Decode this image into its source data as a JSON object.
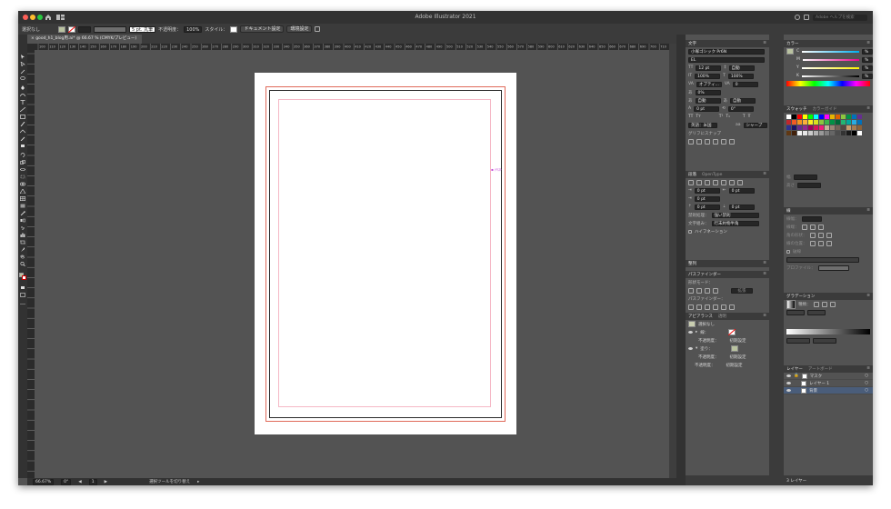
{
  "window": {
    "title": "Adobe Illustrator 2021",
    "help_search_placeholder": "Adobe ヘルプを検索"
  },
  "control_bar": {
    "selection_label": "選択なし",
    "stroke_weight": "",
    "brush_preset": "5 pt. 丸筆",
    "opacity_label": "不透明度：",
    "opacity_value": "100%",
    "style_label": "スタイル：",
    "document_setup_button": "ドキュメント設定",
    "preferences_button": "環境設定"
  },
  "document_tab": {
    "label": "good_h1_blog用.ai* @ 66.67 % (CMYK/プレビュー)"
  },
  "rulers": {
    "horizontal_ticks": [
      "100",
      "110",
      "120",
      "130",
      "140",
      "150",
      "160",
      "170",
      "180",
      "190",
      "200",
      "210",
      "220",
      "230",
      "240",
      "250",
      "260",
      "270",
      "280",
      "290",
      "300",
      "310",
      "320",
      "330",
      "340",
      "350",
      "360",
      "370",
      "380",
      "390",
      "400",
      "410",
      "420",
      "430",
      "440",
      "450",
      "460",
      "470",
      "480",
      "490",
      "500",
      "510",
      "520",
      "530",
      "540",
      "550",
      "560",
      "570",
      "580",
      "590",
      "600",
      "610",
      "620",
      "630",
      "640",
      "650",
      "660",
      "670",
      "680",
      "690",
      "700",
      "710"
    ]
  },
  "canvas": {
    "text_frame_label": "ﾃｷｽﾄ"
  },
  "status_bar": {
    "zoom": "66.67%",
    "rotation": "0°",
    "artboard_number": "1",
    "status_text": "選択ツールを切り替え"
  },
  "character_panel": {
    "tab": "文字",
    "font_family": "小塚ゴシック Pr6N",
    "font_style": "EL",
    "font_size": "12 pt",
    "leading": "自動",
    "vertical_scale": "100%",
    "horizontal_scale": "100%",
    "tracking_label": "オプティ...",
    "kerning": "0",
    "tsume": "0%",
    "aki_left": "自動",
    "aki_right": "自動",
    "baseline_shift": "0 pt",
    "rotation": "0°",
    "language": "英語：米国",
    "antialias": "シャープ",
    "glyph_snap_label": "グリフにスナップ"
  },
  "paragraph_panel": {
    "tab": "段落",
    "tab2": "OpenType",
    "indent_left": "0 pt",
    "indent_right": "0 pt",
    "first_line_indent": "0 pt",
    "space_before": "0 pt",
    "space_after": "0 pt",
    "kinsoku_label": "禁則処理：",
    "kinsoku_value": "強い禁則",
    "mojikumi_label": "文字組み：",
    "mojikumi_value": "行末約物半角",
    "hyphenation_label": "ハイフネーション"
  },
  "align_panel": {
    "tab": "整列"
  },
  "pathfinder_panel": {
    "tab": "パスファインダー",
    "shape_modes_label": "形状モード：",
    "expand_button": "拡張",
    "pathfinders_label": "パスファインダー："
  },
  "appearance_panel": {
    "tab": "アピアランス",
    "tab2": "透明",
    "selection": "選択なし",
    "stroke_label": "線：",
    "fill_label": "塗り：",
    "opacity_label": "不透明度：",
    "opacity_value": "初期設定",
    "default_label": "初期設定"
  },
  "color_panel": {
    "tab": "カラー",
    "channels": [
      "C",
      "M",
      "Y",
      "K"
    ],
    "unit": "%"
  },
  "swatches_panel": {
    "tab": "スウォッチ",
    "tab2": "カラーガイド",
    "colors": [
      "#ffffff",
      "#000000",
      "#ff0000",
      "#ffff00",
      "#00ff00",
      "#00ffff",
      "#0000ff",
      "#ff00ff",
      "#e8b400",
      "#e06000",
      "#8cc63f",
      "#009245",
      "#0071bc",
      "#662d91",
      "#c1272d",
      "#f15a24",
      "#f7931e",
      "#fbb03b",
      "#fcee21",
      "#d9e021",
      "#8cc63f",
      "#39b54a",
      "#009245",
      "#006837",
      "#22b573",
      "#00a99d",
      "#29abe2",
      "#0071bc",
      "#2e3192",
      "#1b1464",
      "#662d91",
      "#93278f",
      "#9e005d",
      "#d4145a",
      "#ed1e79",
      "#c7b299",
      "#998675",
      "#736357",
      "#534741",
      "#c69c6d",
      "#a67c52",
      "#8c6239",
      "#603813",
      "#42210b",
      "#f2f2f2",
      "#e6e6e6",
      "#cccccc",
      "#b3b3b3",
      "#999999",
      "#808080",
      "#666666",
      "#4d4d4d",
      "#333333",
      "#1a1a1a",
      "#000000",
      "#ffffff"
    ]
  },
  "transform_panel": {
    "width_label": "幅",
    "height_label": "高さ"
  },
  "stroke_panel": {
    "tab": "線",
    "weight_label": "線幅：",
    "cap_label": "線端：",
    "corner_label": "角の形状：",
    "align_label": "線の位置：",
    "dash_label": "破線",
    "profile_label": "プロファイル："
  },
  "gradient_panel": {
    "tab": "グラデーション",
    "type_label": "種類："
  },
  "layers_panel": {
    "tab": "レイヤー",
    "tab2": "アートボード",
    "layers": [
      {
        "name": "マスク",
        "selected": false
      },
      {
        "name": "レイヤー 1",
        "selected": false
      },
      {
        "name": "背景",
        "selected": true
      }
    ],
    "layer_count_label": "3 レイヤー"
  },
  "colors": {
    "accent_selection": "#4a5d7a",
    "bleed_guide": "#e06a5a",
    "margin_guide": "#f5b8c6",
    "text_frame": "#c34ad8"
  }
}
